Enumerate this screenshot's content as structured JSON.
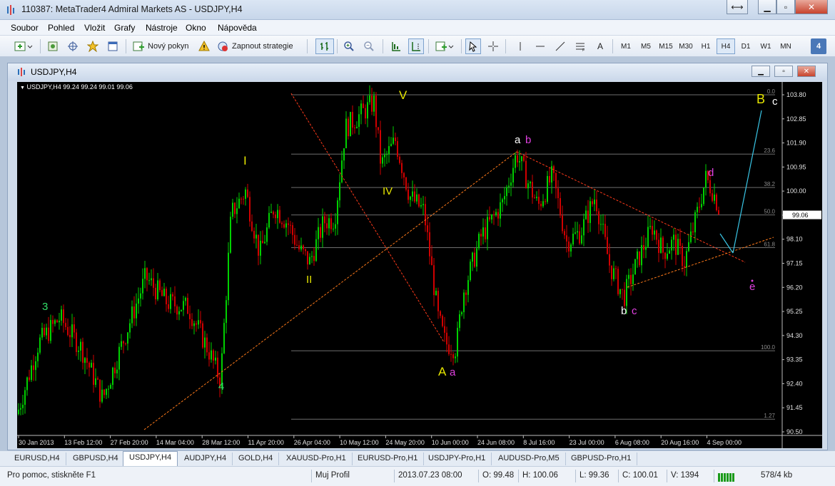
{
  "window": {
    "title": "110387: MetaTrader4 Admiral Markets AS - USDJPY,H4"
  },
  "menu": [
    "Soubor",
    "Pohled",
    "Vložit",
    "Grafy",
    "Nástroje",
    "Okno",
    "Nápověda"
  ],
  "toolbar": {
    "new_order": "Nový pokyn",
    "run_strategy": "Zapnout strategie",
    "text_tool": "A",
    "timeframes": [
      "M1",
      "M5",
      "M15",
      "M30",
      "H1",
      "H4",
      "D1",
      "W1",
      "MN"
    ],
    "active_timeframe": "H4",
    "badge": "4"
  },
  "chart_window": {
    "title": "USDJPY,H4"
  },
  "chart_data": {
    "type": "candlestick",
    "symbol_line": "USDJPY,H4  99.24 99.24 99.01 99.06",
    "current_price": "99.06",
    "y_axis": [
      "103.80",
      "102.85",
      "101.90",
      "100.95",
      "100.00",
      "99.05",
      "98.10",
      "97.15",
      "96.20",
      "95.25",
      "94.30",
      "93.35",
      "92.40",
      "91.45",
      "90.50"
    ],
    "ylim": [
      90.5,
      103.8
    ],
    "x_axis": [
      "30 Jan 2013",
      "13 Feb 12:00",
      "27 Feb 20:00",
      "14 Mar 04:00",
      "28 Mar 12:00",
      "11 Apr 20:00",
      "26 Apr 04:00",
      "10 May 12:00",
      "24 May 20:00",
      "10 Jun 00:00",
      "24 Jun 08:00",
      "8 Jul 16:00",
      "23 Jul 00:00",
      "6 Aug 08:00",
      "20 Aug 16:00",
      "4 Sep 00:00"
    ],
    "fib_levels": [
      "0.0",
      "23.6",
      "38.2",
      "50.0",
      "61.8",
      "100.0",
      "1.27"
    ],
    "fib_prices": [
      103.8,
      101.46,
      100.14,
      99.06,
      97.77,
      93.7,
      91.0
    ],
    "wave_labels": [
      {
        "text": "3",
        "color": "#33e06a",
        "date": "30 Jan",
        "price": 95.3
      },
      {
        "text": "4",
        "color": "#33e06a",
        "date": "28 Mar",
        "price": 92.0
      },
      {
        "text": "I",
        "color": "#e6e600",
        "date": "11 Apr",
        "price": 101.0
      },
      {
        "text": "II",
        "color": "#e6e600",
        "date": "26 Apr",
        "price": 96.0
      },
      {
        "text": "V",
        "color": "#e6e600",
        "date": "24 May",
        "price": 103.5
      },
      {
        "text": "IV",
        "color": "#e6e600",
        "date": "24 May",
        "price": 100.2
      },
      {
        "text": "A",
        "color": "#e6e600",
        "date": "10 Jun",
        "price": 93.1
      },
      {
        "text": "a",
        "color": "#e040e0",
        "date": "10 Jun",
        "price": 93.1
      },
      {
        "text": "a",
        "color": "#ffffff",
        "date": "8 Jul",
        "price": 101.9
      },
      {
        "text": "b",
        "color": "#e040e0",
        "date": "8 Jul",
        "price": 101.9
      },
      {
        "text": "b",
        "color": "#ffffff",
        "date": "6 Aug",
        "price": 95.3
      },
      {
        "text": "c",
        "color": "#e040e0",
        "date": "6 Aug",
        "price": 95.3
      },
      {
        "text": "d",
        "color": "#e040e0",
        "date": "4 Sep",
        "price": 100.6
      },
      {
        "text": "e",
        "color": "#e040e0",
        "date": "4 Sep",
        "price": 96.0
      },
      {
        "text": "B",
        "color": "#e6e600",
        "date": "Sep",
        "price": 103.5
      },
      {
        "text": "c",
        "color": "#ffffff",
        "date": "Sep",
        "price": 103.4
      }
    ],
    "colors": {
      "bull": "#00d000",
      "bear": "#d00000",
      "trendline": "#ff7a1a",
      "projection": "#39c6e6",
      "grid": "#6e6e6e"
    }
  },
  "tabs": [
    "EURUSD,H4",
    "GBPUSD,H4",
    "USDJPY,H4",
    "AUDJPY,H4",
    "GOLD,H4",
    "XAUUSD-Pro,H1",
    "EURUSD-Pro,H1",
    "USDJPY-Pro,H1",
    "AUDUSD-Pro,M5",
    "GBPUSD-Pro,H1"
  ],
  "active_tab": "USDJPY,H4",
  "status": {
    "help": "Pro pomoc, stiskněte F1",
    "profile": "Muj Profil",
    "datetime": "2013.07.23 08:00",
    "open": "O: 99.48",
    "high": "H: 100.06",
    "low": "L: 99.36",
    "close": "C: 100.01",
    "volume": "V: 1394",
    "traffic": "578/4 kb"
  }
}
